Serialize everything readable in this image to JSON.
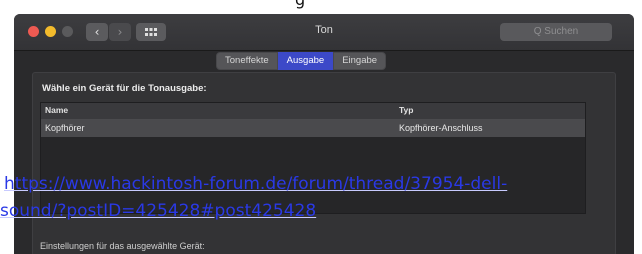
{
  "window": {
    "title": "Ton",
    "nav_back": "‹",
    "nav_forward": "›",
    "search_placeholder": "Q Suchen"
  },
  "tabs": [
    {
      "label": "Toneffekte",
      "active": false
    },
    {
      "label": "Ausgabe",
      "active": true
    },
    {
      "label": "Eingabe",
      "active": false
    }
  ],
  "output": {
    "heading": "Wähle ein Gerät für die Tonausgabe:",
    "columns": [
      "Name",
      "Typ"
    ],
    "rows": [
      {
        "name": "Kopfhörer",
        "type": "Kopfhörer-Anschluss"
      }
    ],
    "settings_label": "Einstellungen für das ausgewählte Gerät:"
  },
  "overlay_link": {
    "line1": "https://www.hackintosh-forum.de/forum/thread/37954-dell-",
    "line2": "sound/?postID=425428#post425428"
  },
  "colors": {
    "accent": "#3c49c8",
    "link": "#2a39e6",
    "close": "#ee5a52",
    "minimize": "#f3bb2c"
  }
}
